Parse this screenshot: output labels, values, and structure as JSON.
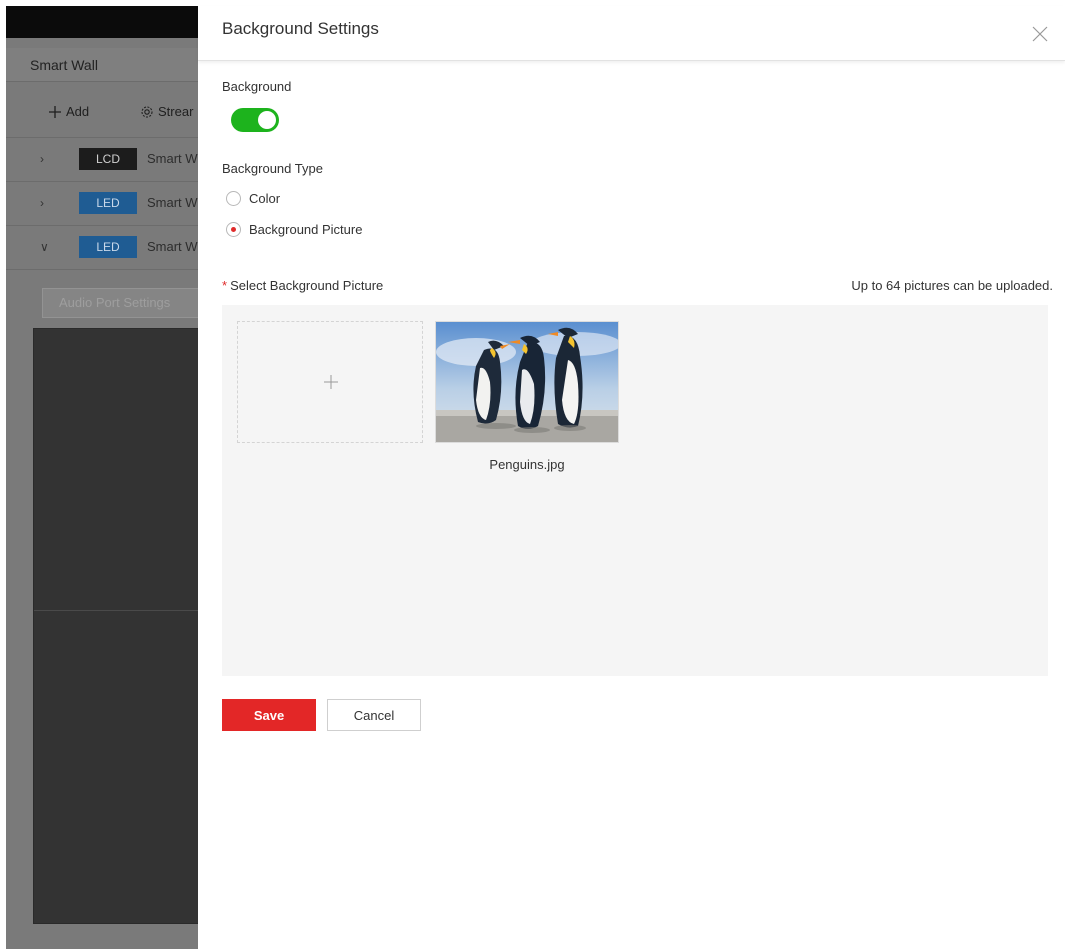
{
  "background_app": {
    "title": "Smart Wall",
    "toolbar": {
      "add_label": "Add",
      "add_icon": "plus-icon",
      "stream_label": "Strear",
      "stream_icon": "gear-icon"
    },
    "walls": [
      {
        "tag": "LCD",
        "name": "Smart W",
        "expanded": false
      },
      {
        "tag": "LED",
        "name": "Smart W",
        "expanded": false
      },
      {
        "tag": "LED",
        "name": "Smart W",
        "expanded": true
      }
    ],
    "audio_button_label": "Audio Port Settings"
  },
  "drawer": {
    "title": "Background Settings",
    "close_icon": "close-icon",
    "background_label": "Background",
    "background_enabled": true,
    "toggle_color": "#1db31d",
    "type_label": "Background Type",
    "type_options": [
      {
        "label": "Color",
        "checked": false
      },
      {
        "label": "Background Picture",
        "checked": true
      }
    ],
    "select_picture_required_mark": "*",
    "select_picture_label": "Select Background Picture",
    "upload_hint": "Up to 64 pictures can be uploaded.",
    "upload_icon": "plus-icon",
    "pictures": [
      {
        "name": "Penguins.jpg"
      }
    ],
    "save_label": "Save",
    "cancel_label": "Cancel",
    "accent_color": "#e32727"
  }
}
